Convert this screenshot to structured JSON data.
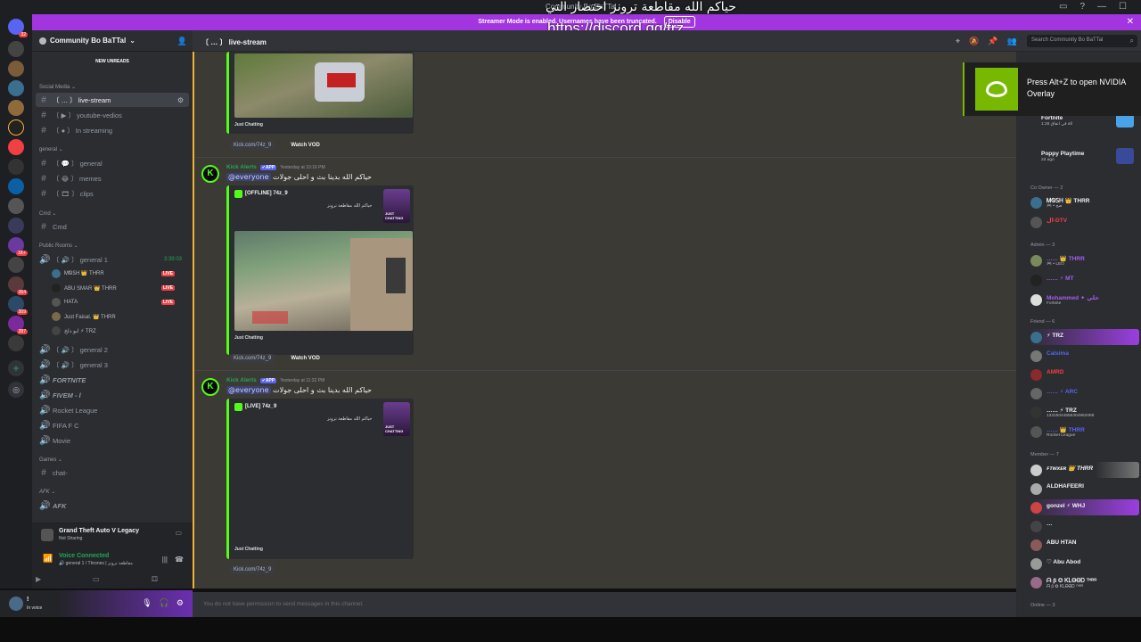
{
  "titlebar": {
    "title": "Community Bo BaTTal"
  },
  "overlay": {
    "arabic_text": "حياكم الله مقاطعة ترونز اختصار التي",
    "invite_url": "https://discord.gg/trz"
  },
  "banner": {
    "text": "Streamer Mode is enabled. Usernames have been truncated.",
    "disable_label": "Disable",
    "close": "✕"
  },
  "guild_badges": [
    "32",
    "1K+",
    "364",
    "309",
    "287"
  ],
  "server": {
    "name": "Community Bo BaTTal"
  },
  "sidebar": {
    "new_unreads": "NEW UNREADS",
    "categories": {
      "social_media": "Social Media",
      "general": "general",
      "cmd": "Cmd",
      "public_rooms": "Public Rooms",
      "games": "Games",
      "afk_cat": "AFK"
    },
    "channels": {
      "live_stream": "〔 … 〕 live-stream",
      "youtube": "〔 ▶ 〕 youtube-vedios",
      "in_streaming": "〔 ● 〕 In streaming",
      "general": "〔 💬 〕 general",
      "memes": "〔 😂 〕 memes",
      "clips": "〔 🎞 〕 clips",
      "cmd": "Cmd",
      "general1": "〔 🔊 〕 general 1",
      "general2": "〔 🔊 〕 general 2",
      "general3": "〔 🔊 〕 general 3",
      "fortnite": "FORTNITE",
      "fivem": "FIVEM - l",
      "rocket": "Rocket League",
      "fifa": "FIFA F C",
      "movie": "Movie",
      "chat": "chat-",
      "afk": "AFK"
    },
    "general1_timer": "3:39:03",
    "voice_users": [
      {
        "name": "ᎷᏫᏚᎻ 👑 THRR",
        "live": "LIVE"
      },
      {
        "name": "ABU SMAR 👑 THRR",
        "live": "LIVE"
      },
      {
        "name": "HATA",
        "live": "LIVE"
      },
      {
        "name": "Just Faisal. 👑 THRR",
        "live": ""
      },
      {
        "name": "ابو دلخ ⚡ TRZ",
        "live": ""
      }
    ]
  },
  "activity": {
    "title": "Grand Theft Auto V Legacy",
    "subtitle": "Not Sharing"
  },
  "voice": {
    "status": "Voice Connected",
    "channel": "🔊 general 1 / Thrones | مقاطعة ترونز"
  },
  "user": {
    "name": "!",
    "status": "In voice"
  },
  "channel_header": {
    "name": "〔 … 〕 live-stream",
    "search_placeholder": "Search Community Bo BaTTal"
  },
  "messages": [
    {
      "embed_footer": "Just Chatting",
      "link": "Kick.com/74z_9",
      "vod": "Watch VOD"
    },
    {
      "author": "Kick Alerts",
      "app_tag": "✔APP",
      "timestamp": "Yesterday at 10:16 PM",
      "mention": "@everyone",
      "text": "حياكم الله بدينا بث و احلى جولات",
      "embed_title": "[OFFLINE] 74z_9",
      "embed_desc": "حياكم الله مقاطعة ترونز",
      "thumb_label": "JUST CHATTING",
      "embed_footer": "Just Chatting",
      "link": "Kick.com/74z_9",
      "vod": "Watch VOD"
    },
    {
      "author": "Kick Alerts",
      "app_tag": "✔APP",
      "timestamp": "Yesterday at 11:32 PM",
      "mention": "@everyone",
      "text": "حياكم الله بدينا بث و احلى جولات",
      "embed_title": "[LIVE] 74z_9",
      "embed_desc": "حياكم الله مقاطعة ترونز",
      "thumb_label": "JUST CHATTING",
      "embed_footer": "Just Chatting",
      "link": "Kick.com/74z_9"
    }
  ],
  "composer": {
    "placeholder": "You do not have permission to send messages in this channel."
  },
  "nvidia": {
    "text": "Press Alt+Z to open NVIDIA Overlay"
  },
  "members": {
    "top_activities": [
      {
        "game": "Fortnite",
        "sub": "1:28 في اتفاق all"
      },
      {
        "game": "Poppy Playtime",
        "sub": "2d ago"
      }
    ],
    "co_owner_label": "Co Owner — 2",
    "co_owners": [
      {
        "name": "ᎷᏫᏚᎻ 👑 THRR",
        "sub": "🎮 • صح"
      },
      {
        "name": "ال-DTV",
        "sub": ""
      }
    ],
    "admin_label": "Admin — 3",
    "admins": [
      {
        "name": "…… 👑 THRR",
        "sub": "🎮 • LEO"
      },
      {
        "name": "…… ⚡ MT",
        "sub": ""
      },
      {
        "name": "Mohammed ✦ خلي",
        "sub": "Fortnite"
      }
    ],
    "friend_label": "Friend — 6",
    "friends": [
      {
        "name": "⚡ TRZ",
        "sub": ""
      },
      {
        "name": "Calsima",
        "sub": ""
      },
      {
        "name": "AMRD",
        "sub": ""
      },
      {
        "name": "…… ⚡ ARC",
        "sub": ""
      },
      {
        "name": "…… ⚡ TRZ",
        "sub": "13315044656304962088"
      },
      {
        "name": "…… 👑 THRR",
        "sub": "Rocket League"
      }
    ],
    "member_label": "Member — 7",
    "member_list": [
      {
        "name": "ꜰᴛᴡxᴇʀ 👑 THRR",
        "sub": ""
      },
      {
        "name": "ALDHAFEERI",
        "sub": ""
      },
      {
        "name": "gonzel ⚡ WHJ",
        "sub": ""
      },
      {
        "name": "…",
        "sub": ""
      },
      {
        "name": "ABU HTAN",
        "sub": ""
      },
      {
        "name": "♡ Abu Abod",
        "sub": ""
      },
      {
        "name": "ᗩ β ✪ ᏦᏞᎾᎾᎠ ᵀᴴᴿᴿ",
        "sub": "ᗩ β ✪ ᏦᏞᎾᎾᎠ ᵀᴴᴿᴿ"
      }
    ],
    "online_label": "Online — 3"
  },
  "colors": {
    "accent": "#5865f2",
    "kick_green": "#53fc18",
    "boost_purple": "#a335e0",
    "nvidia_green": "#76b900"
  }
}
